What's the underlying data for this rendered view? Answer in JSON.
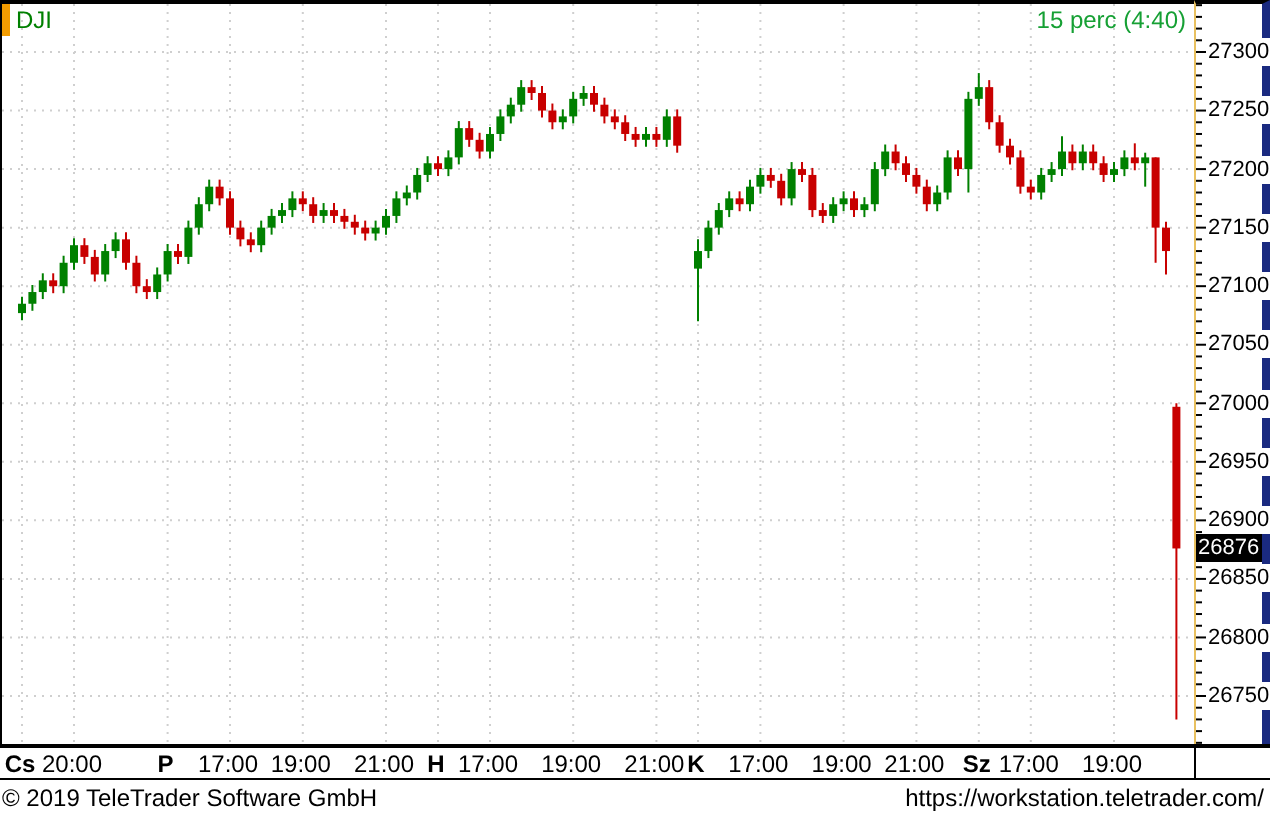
{
  "symbol": "DJI",
  "interval": "15 perc (4:40)",
  "last_price": "26876",
  "chart_data": {
    "type": "candlestick",
    "ylim": [
      26709,
      27341
    ],
    "yticks": [
      26750,
      26800,
      26850,
      26900,
      26950,
      27000,
      27050,
      27100,
      27150,
      27200,
      27250,
      27300
    ],
    "grid": true,
    "categories": [
      "**Cs**",
      null,
      null,
      null,
      null,
      "20:00",
      null,
      null,
      null,
      null,
      null,
      null,
      null,
      null,
      "**P**",
      null,
      null,
      null,
      null,
      null,
      "17:00",
      null,
      null,
      null,
      null,
      null,
      null,
      "19:00",
      null,
      null,
      null,
      null,
      null,
      null,
      null,
      "21:00",
      null,
      null,
      null,
      null,
      "**H**",
      null,
      null,
      null,
      null,
      "17:00",
      null,
      null,
      null,
      null,
      null,
      null,
      null,
      "19:00",
      null,
      null,
      null,
      null,
      null,
      null,
      null,
      "21:00",
      null,
      null,
      null,
      "**K**",
      null,
      null,
      null,
      null,
      null,
      "17:00",
      null,
      null,
      null,
      null,
      null,
      null,
      null,
      "19:00",
      null,
      null,
      null,
      null,
      null,
      null,
      "21:00",
      null,
      null,
      null,
      null,
      null,
      "**Sz**",
      null,
      null,
      null,
      null,
      "17:00",
      null,
      null,
      null,
      null,
      null,
      null,
      null,
      "19:00",
      null,
      null,
      null,
      null,
      null,
      null
    ],
    "ohlc": [
      [
        27077,
        27091,
        27071,
        27085
      ],
      [
        27085,
        27101,
        27079,
        27095
      ],
      [
        27095,
        27111,
        27089,
        27105
      ],
      [
        27105,
        27111,
        27094,
        27100
      ],
      [
        27100,
        27126,
        27094,
        27120
      ],
      [
        27120,
        27141,
        27114,
        27135
      ],
      [
        27135,
        27141,
        27119,
        27125
      ],
      [
        27125,
        27131,
        27104,
        27110
      ],
      [
        27110,
        27136,
        27104,
        27130
      ],
      [
        27130,
        27146,
        27124,
        27140
      ],
      [
        27140,
        27146,
        27114,
        27120
      ],
      [
        27120,
        27126,
        27094,
        27100
      ],
      [
        27100,
        27106,
        27089,
        27095
      ],
      [
        27095,
        27116,
        27089,
        27110
      ],
      [
        27110,
        27136,
        27104,
        27130
      ],
      [
        27130,
        27136,
        27119,
        27125
      ],
      [
        27125,
        27156,
        27119,
        27150
      ],
      [
        27150,
        27176,
        27144,
        27170
      ],
      [
        27170,
        27191,
        27164,
        27185
      ],
      [
        27185,
        27191,
        27169,
        27175
      ],
      [
        27175,
        27181,
        27144,
        27150
      ],
      [
        27150,
        27156,
        27134,
        27140
      ],
      [
        27140,
        27146,
        27129,
        27135
      ],
      [
        27135,
        27156,
        27129,
        27150
      ],
      [
        27150,
        27166,
        27144,
        27160
      ],
      [
        27160,
        27171,
        27154,
        27165
      ],
      [
        27165,
        27181,
        27159,
        27175
      ],
      [
        27175,
        27181,
        27164,
        27170
      ],
      [
        27170,
        27176,
        27154,
        27160
      ],
      [
        27160,
        27171,
        27154,
        27165
      ],
      [
        27165,
        27171,
        27154,
        27160
      ],
      [
        27160,
        27166,
        27149,
        27155
      ],
      [
        27155,
        27161,
        27144,
        27150
      ],
      [
        27150,
        27156,
        27139,
        27145
      ],
      [
        27145,
        27156,
        27139,
        27150
      ],
      [
        27150,
        27166,
        27144,
        27160
      ],
      [
        27160,
        27181,
        27154,
        27175
      ],
      [
        27175,
        27186,
        27169,
        27180
      ],
      [
        27180,
        27201,
        27174,
        27195
      ],
      [
        27195,
        27211,
        27189,
        27205
      ],
      [
        27205,
        27211,
        27194,
        27200
      ],
      [
        27200,
        27216,
        27194,
        27210
      ],
      [
        27210,
        27241,
        27204,
        27235
      ],
      [
        27235,
        27241,
        27219,
        27225
      ],
      [
        27225,
        27231,
        27209,
        27215
      ],
      [
        27215,
        27236,
        27209,
        27230
      ],
      [
        27230,
        27251,
        27224,
        27245
      ],
      [
        27245,
        27261,
        27239,
        27255
      ],
      [
        27255,
        27276,
        27249,
        27270
      ],
      [
        27270,
        27276,
        27259,
        27265
      ],
      [
        27265,
        27271,
        27244,
        27250
      ],
      [
        27250,
        27256,
        27234,
        27240
      ],
      [
        27240,
        27251,
        27234,
        27245
      ],
      [
        27245,
        27266,
        27239,
        27260
      ],
      [
        27260,
        27271,
        27254,
        27265
      ],
      [
        27265,
        27271,
        27249,
        27255
      ],
      [
        27255,
        27261,
        27239,
        27245
      ],
      [
        27245,
        27251,
        27234,
        27240
      ],
      [
        27240,
        27246,
        27224,
        27230
      ],
      [
        27230,
        27236,
        27219,
        27225
      ],
      [
        27225,
        27236,
        27219,
        27230
      ],
      [
        27230,
        27236,
        27219,
        27225
      ],
      [
        27225,
        27251,
        27219,
        27245
      ],
      [
        27245,
        27251,
        27214,
        27220
      ],
      null,
      [
        27115,
        27140,
        27070,
        27130
      ],
      [
        27130,
        27156,
        27124,
        27150
      ],
      [
        27150,
        27171,
        27144,
        27165
      ],
      [
        27165,
        27181,
        27159,
        27175
      ],
      [
        27175,
        27181,
        27164,
        27170
      ],
      [
        27170,
        27191,
        27164,
        27185
      ],
      [
        27185,
        27201,
        27179,
        27195
      ],
      [
        27195,
        27201,
        27184,
        27190
      ],
      [
        27190,
        27196,
        27169,
        27175
      ],
      [
        27175,
        27206,
        27169,
        27200
      ],
      [
        27200,
        27206,
        27189,
        27195
      ],
      [
        27195,
        27201,
        27159,
        27165
      ],
      [
        27165,
        27171,
        27154,
        27160
      ],
      [
        27160,
        27176,
        27154,
        27170
      ],
      [
        27170,
        27181,
        27164,
        27175
      ],
      [
        27175,
        27181,
        27159,
        27165
      ],
      [
        27165,
        27176,
        27159,
        27170
      ],
      [
        27170,
        27206,
        27164,
        27200
      ],
      [
        27200,
        27221,
        27194,
        27215
      ],
      [
        27215,
        27221,
        27199,
        27205
      ],
      [
        27205,
        27211,
        27189,
        27195
      ],
      [
        27195,
        27201,
        27179,
        27185
      ],
      [
        27185,
        27191,
        27164,
        27170
      ],
      [
        27170,
        27186,
        27164,
        27180
      ],
      [
        27180,
        27216,
        27174,
        27210
      ],
      [
        27210,
        27216,
        27194,
        27200
      ],
      [
        27200,
        27266,
        27180,
        27260
      ],
      [
        27260,
        27282,
        27254,
        27270
      ],
      [
        27270,
        27276,
        27234,
        27240
      ],
      [
        27240,
        27246,
        27214,
        27220
      ],
      [
        27220,
        27226,
        27204,
        27210
      ],
      [
        27210,
        27216,
        27179,
        27185
      ],
      [
        27185,
        27191,
        27174,
        27180
      ],
      [
        27180,
        27201,
        27174,
        27195
      ],
      [
        27195,
        27206,
        27189,
        27200
      ],
      [
        27200,
        27228,
        27194,
        27215
      ],
      [
        27215,
        27221,
        27199,
        27205
      ],
      [
        27205,
        27221,
        27199,
        27215
      ],
      [
        27215,
        27221,
        27199,
        27205
      ],
      [
        27205,
        27211,
        27189,
        27195
      ],
      [
        27195,
        27206,
        27189,
        27200
      ],
      [
        27200,
        27216,
        27194,
        27210
      ],
      [
        27210,
        27222,
        27199,
        27205
      ],
      [
        27205,
        27214,
        27185,
        27210
      ],
      [
        27210,
        27210,
        27120,
        27150
      ],
      [
        27150,
        27155,
        27110,
        27130
      ],
      [
        26997,
        27000,
        26730,
        26876
      ]
    ]
  },
  "copyright": "© 2019 TeleTrader Software GmbH",
  "url": "https://workstation.teletrader.com/"
}
